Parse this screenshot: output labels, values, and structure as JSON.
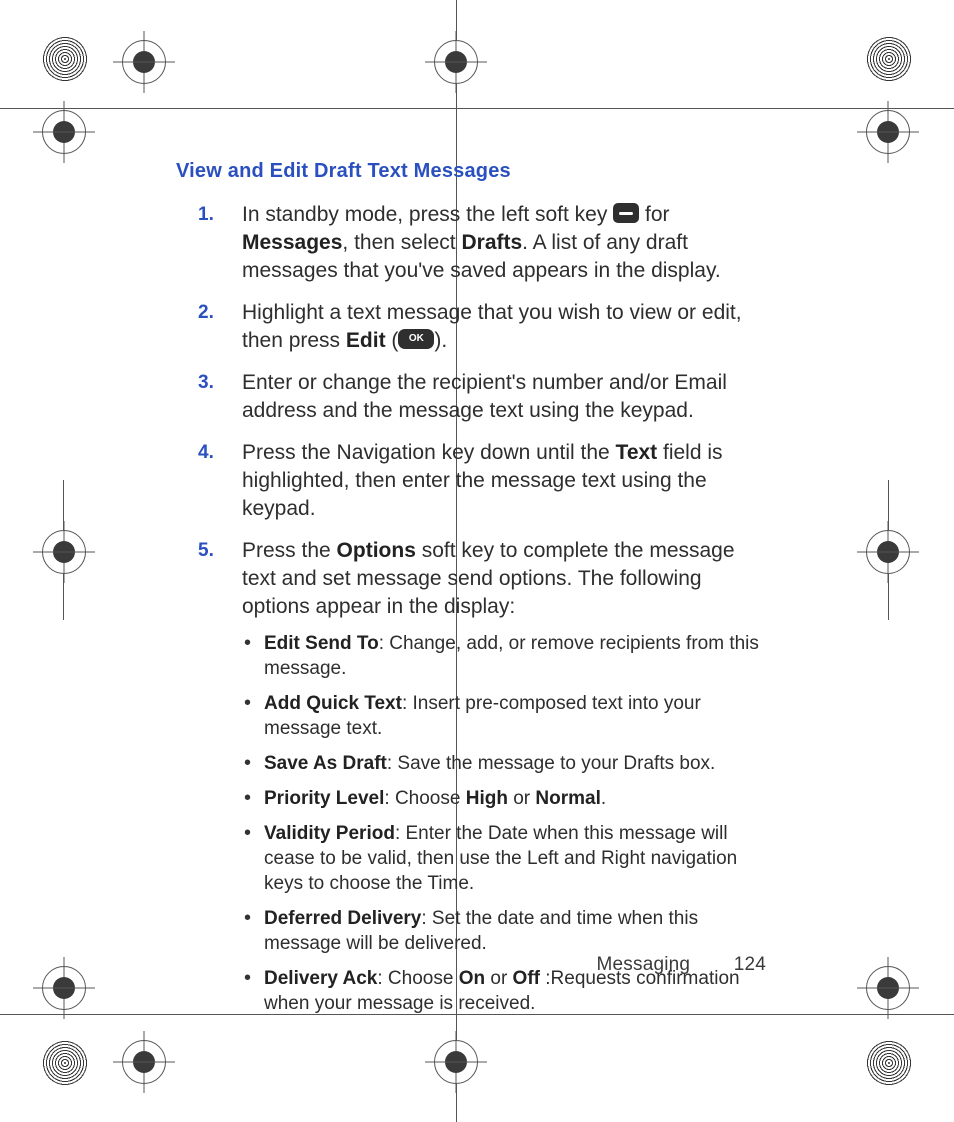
{
  "heading": "View and Edit Draft Text Messages",
  "steps": [
    {
      "num": "1.",
      "parts": [
        {
          "t": "In standby mode, press the left soft key "
        },
        {
          "icon": "dash"
        },
        {
          "t": " for "
        },
        {
          "b": "Messages"
        },
        {
          "t": ", then select "
        },
        {
          "b": "Drafts"
        },
        {
          "t": ". A list of any draft messages that you've saved appears in the display."
        }
      ]
    },
    {
      "num": "2.",
      "parts": [
        {
          "t": "Highlight a text message that you wish to view or edit, then press "
        },
        {
          "b": "Edit"
        },
        {
          "t": " ("
        },
        {
          "icon": "ok"
        },
        {
          "t": ")."
        }
      ]
    },
    {
      "num": "3.",
      "parts": [
        {
          "t": "Enter or change the recipient's number and/or Email address and the message text using the keypad."
        }
      ]
    },
    {
      "num": "4.",
      "parts": [
        {
          "t": "Press the Navigation key down until the "
        },
        {
          "b": "Text"
        },
        {
          "t": " field is highlighted, then enter the message text using the keypad."
        }
      ]
    },
    {
      "num": "5.",
      "parts": [
        {
          "t": "Press the "
        },
        {
          "b": "Options"
        },
        {
          "t": " soft key to complete the message text and set message send options. The following options appear in the display:"
        }
      ],
      "options": [
        [
          {
            "b": "Edit Send To"
          },
          {
            "t": ": Change, add, or remove recipients from this message."
          }
        ],
        [
          {
            "b": "Add Quick Text"
          },
          {
            "t": ": Insert pre-composed text into your message text."
          }
        ],
        [
          {
            "b": "Save As Draft"
          },
          {
            "t": ": Save the message to your Drafts box."
          }
        ],
        [
          {
            "b": "Priority Level"
          },
          {
            "t": ": Choose "
          },
          {
            "b": "High"
          },
          {
            "t": " or "
          },
          {
            "b": "Normal"
          },
          {
            "t": "."
          }
        ],
        [
          {
            "b": "Validity Period"
          },
          {
            "t": ": Enter the Date when this message will cease to be valid, then use the Left and Right navigation keys to choose the Time."
          }
        ],
        [
          {
            "b": "Deferred Delivery"
          },
          {
            "t": ": Set the date and time when this message will be delivered."
          }
        ],
        [
          {
            "b": "Delivery Ack"
          },
          {
            "t": ": Choose "
          },
          {
            "b": "On"
          },
          {
            "t": " or "
          },
          {
            "b": "Off"
          },
          {
            "t": " :Requests confirmation when your message is received."
          }
        ]
      ]
    }
  ],
  "footer": {
    "section": "Messaging",
    "page": "124"
  },
  "icons": {
    "ok_label": "OK"
  }
}
